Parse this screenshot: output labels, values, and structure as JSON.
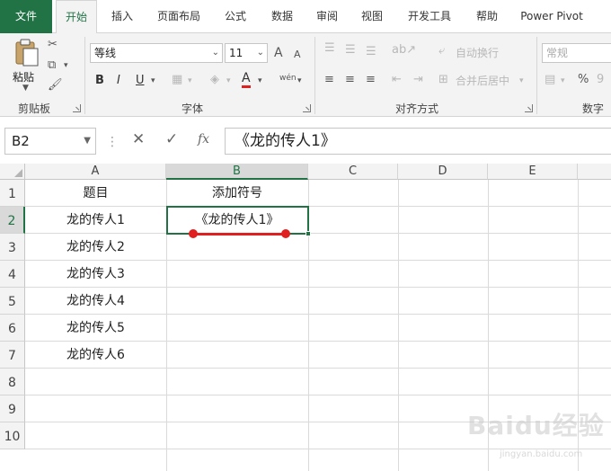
{
  "tabs": [
    "文件",
    "开始",
    "插入",
    "页面布局",
    "公式",
    "数据",
    "审阅",
    "视图",
    "开发工具",
    "帮助",
    "Power Pivot"
  ],
  "ribbon": {
    "clipboard": {
      "paste_label": "粘贴",
      "group_label": "剪贴板"
    },
    "font": {
      "font_name": "等线",
      "font_size": "11",
      "bold": "B",
      "italic": "I",
      "underline": "U",
      "grow": "A",
      "shrink": "A",
      "color_a": "A",
      "phonetic": "wén",
      "group_label": "字体"
    },
    "alignment": {
      "wrap_text": "自动换行",
      "merge_center": "合并后居中",
      "group_label": "对齐方式"
    },
    "number": {
      "format": "常规",
      "percent": "%",
      "group_label": "数字"
    }
  },
  "formula_bar": {
    "name_box": "B2",
    "cancel": "✕",
    "enter": "✓",
    "fx": "fx",
    "formula": "《龙的传人1》"
  },
  "grid": {
    "columns": [
      "A",
      "B",
      "C",
      "D",
      "E"
    ],
    "rows": [
      "1",
      "2",
      "3",
      "4",
      "5",
      "6",
      "7",
      "8",
      "9",
      "10"
    ],
    "cells": {
      "A1": "题目",
      "B1": "添加符号",
      "A2": "龙的传人1",
      "B2": "《龙的传人1》",
      "A3": "龙的传人2",
      "A4": "龙的传人3",
      "A5": "龙的传人4",
      "A6": "龙的传人5",
      "A7": "龙的传人6"
    },
    "selected_cell": "B2"
  },
  "colors": {
    "accent": "#217346",
    "annotation": "#e02020"
  },
  "watermark": {
    "main": "Baidu经验",
    "sub": "jingyan.baidu.com"
  }
}
